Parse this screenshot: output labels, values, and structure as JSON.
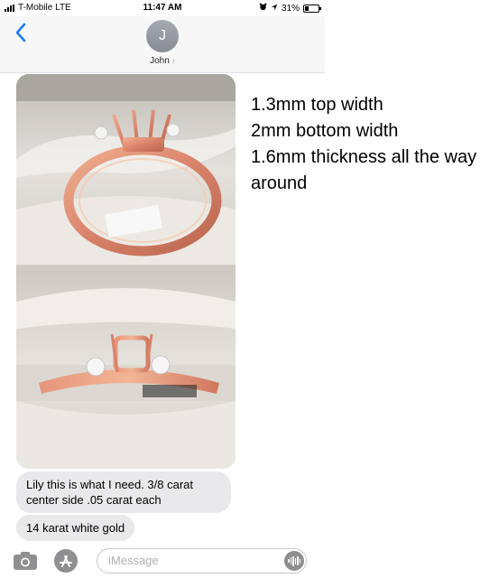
{
  "status_bar": {
    "carrier": "T-Mobile LTE",
    "time": "11:47 AM",
    "battery": "31%",
    "battery_level": 0.31
  },
  "header": {
    "avatar_initial": "J",
    "contact_name": "John",
    "chevron": "›"
  },
  "messages": [
    "Lily this is what I need. 3/8 carat center side .05 carat each",
    "14 karat white gold"
  ],
  "input": {
    "placeholder": "iMessage"
  },
  "notes": [
    "1.3mm top width",
    "2mm bottom width",
    "1.6mm thickness all the way around"
  ],
  "colors": {
    "ios_blue": "#1a7cf5",
    "bubble_gray": "#e9e9eb",
    "rose_gold": "#d9896a"
  },
  "icons": [
    "signal-icon",
    "alarm-icon",
    "location-arrow-icon",
    "battery-icon",
    "back-chevron-icon",
    "camera-icon",
    "app-store-icon",
    "audio-waveform-icon"
  ]
}
